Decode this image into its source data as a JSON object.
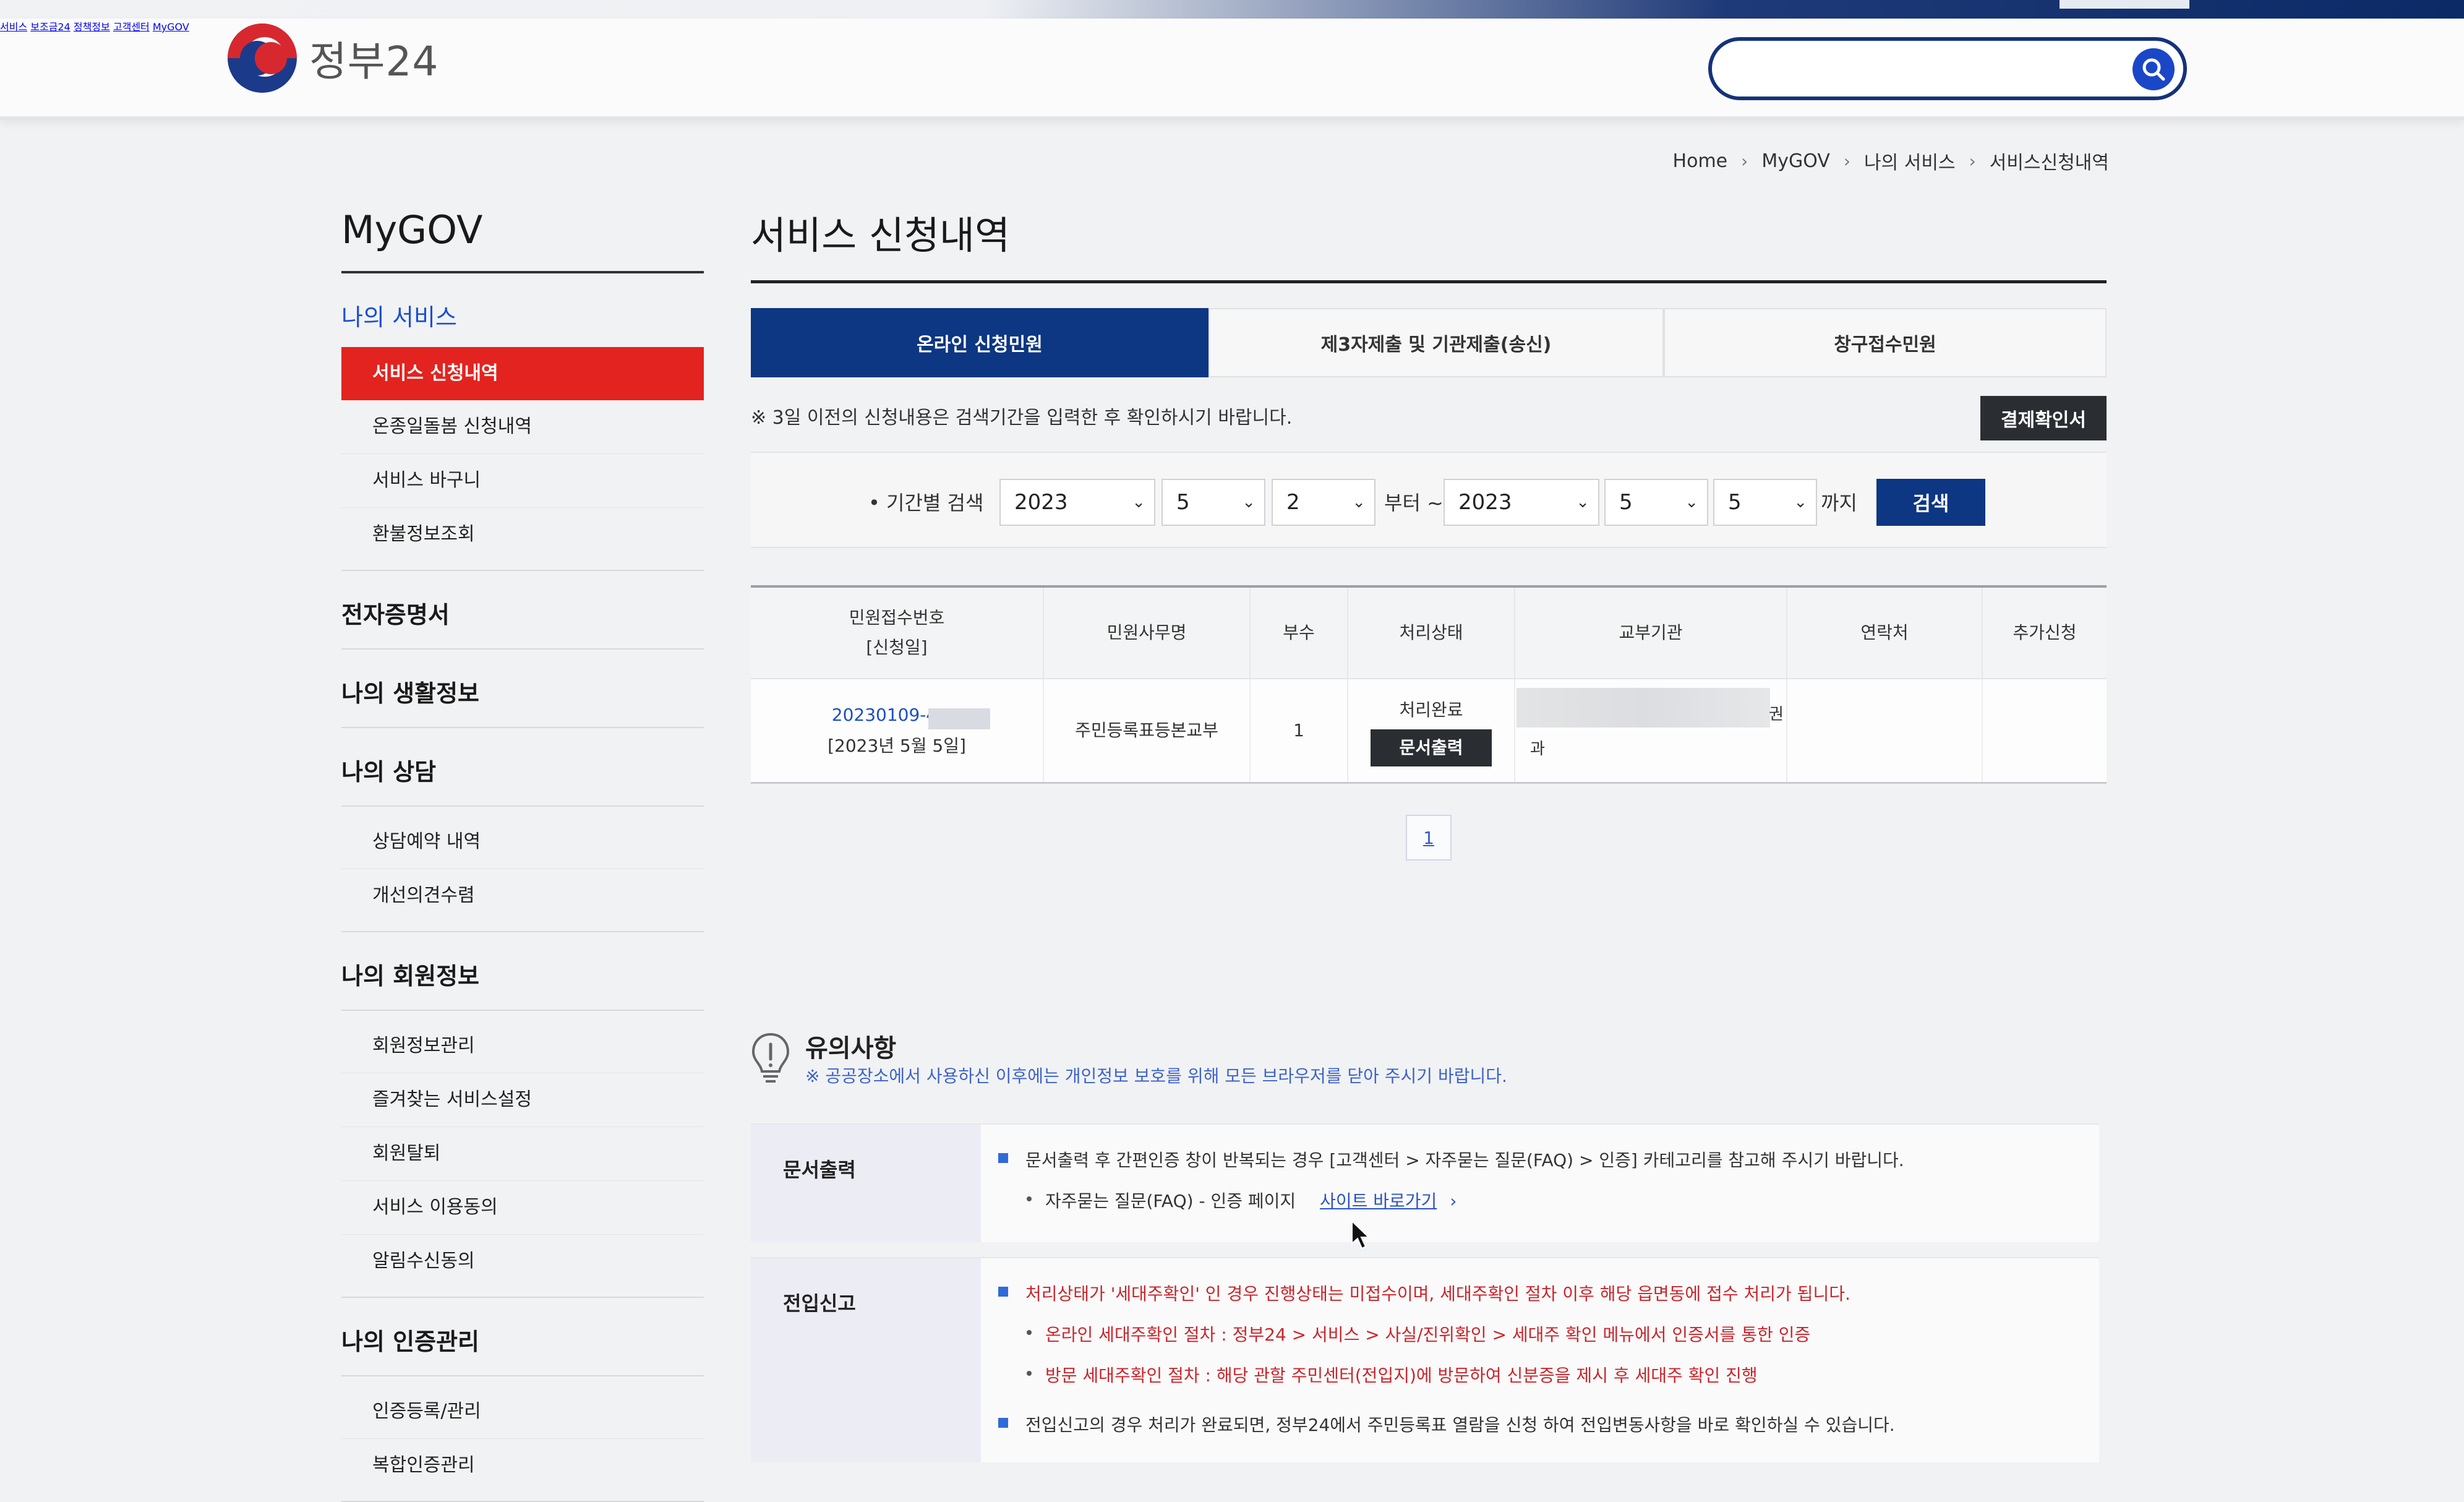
{
  "header": {
    "logo_text": "정부24",
    "nav": [
      "서비스",
      "보조금24",
      "정책정보",
      "고객센터",
      "MyGOV"
    ],
    "search_placeholder": ""
  },
  "breadcrumb": [
    "Home",
    "MyGOV",
    "나의 서비스",
    "서비스신청내역"
  ],
  "sidebar": {
    "title": "MyGOV",
    "my_service": {
      "label": "나의 서비스",
      "items": [
        "서비스 신청내역",
        "온종일돌봄 신청내역",
        "서비스 바구니",
        "환불정보조회"
      ]
    },
    "e_cert": "전자증명서",
    "life_info": "나의 생활정보",
    "consult": {
      "label": "나의 상담",
      "items": [
        "상담예약 내역",
        "개선의견수렴"
      ]
    },
    "member": {
      "label": "나의 회원정보",
      "items": [
        "회원정보관리",
        "즐겨찾는 서비스설정",
        "회원탈퇴",
        "서비스 이용동의",
        "알림수신동의"
      ]
    },
    "auth": {
      "label": "나의 인증관리",
      "items": [
        "인증등록/관리",
        "복합인증관리"
      ]
    }
  },
  "main": {
    "title": "서비스 신청내역",
    "tabs": [
      "온라인 신청민원",
      "제3자제출 및 기관제출(송신)",
      "창구접수민원"
    ],
    "notice": "※ 3일 이전의 신청내용은 검색기간을 입력한 후 확인하시기 바랍니다.",
    "payment_button": "결제확인서",
    "filter": {
      "label": "• 기간별 검색",
      "from_year": "2023",
      "from_month": "5",
      "from_day": "2",
      "from_text": "부터 ~",
      "to_year": "2023",
      "to_month": "5",
      "to_day": "5",
      "to_text": "까지",
      "search_button": "검색"
    },
    "table": {
      "headers": [
        "민원접수번호",
        "[신청일]",
        "민원사무명",
        "부수",
        "처리상태",
        "교부기관",
        "연락처",
        "추가신청"
      ],
      "row": {
        "receipt_no": "20230109-4",
        "date": "[2023년 5월 5일]",
        "service": "주민등록표등본교부",
        "copies": "1",
        "status": "처리완료",
        "print_button": "문서출력",
        "agency_suffix_1": "권",
        "agency_suffix_2": "과"
      }
    },
    "page": "1"
  },
  "caution": {
    "title": "유의사항",
    "subtitle": "※ 공공장소에서 사용하신 이후에는 개인정보 보호를 위해 모든 브라우저를 닫아 주시기 바랍니다.",
    "print": {
      "label": "문서출력",
      "line1": "문서출력 후 간편인증 창이 반복되는 경우 [고객센터 > 자주묻는 질문(FAQ) > 인증] 카테고리를 참고해 주시기 바랍니다.",
      "line2": "자주묻는 질문(FAQ) - 인증 페이지",
      "link": "사이트 바로가기",
      "link_arrow": "›"
    },
    "move": {
      "label": "전입신고",
      "line1": "처리상태가 '세대주확인' 인 경우 진행상태는 미접수이며, 세대주확인 절차 이후 해당 읍면동에 접수 처리가 됩니다.",
      "line2": "온라인 세대주확인 절차 : 정부24 > 서비스 > 사실/진위확인 > 세대주 확인 메뉴에서 인증서를 통한 인증",
      "line3": "방문 세대주확인 절차 : 해당 관할 주민센터(전입지)에 방문하여 신분증을 제시 후 세대주 확인 진행",
      "line4": "전입신고의 경우 처리가 완료되면, 정부24에서 주민등록표 열람을 신청 하여 전입변동사항을 바로 확인하실 수 있습니다."
    }
  }
}
